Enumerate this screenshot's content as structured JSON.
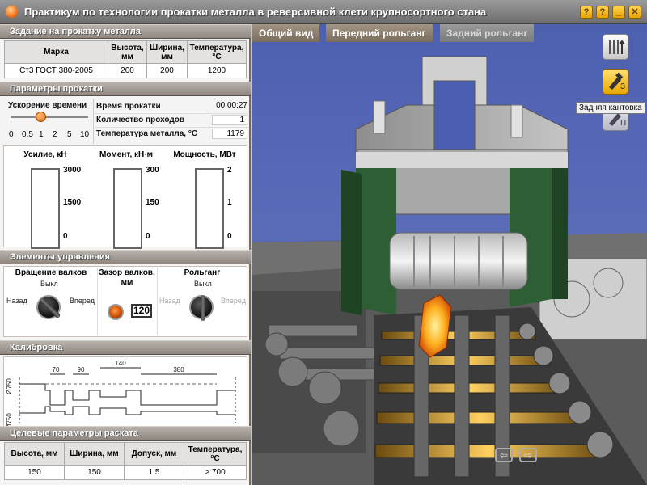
{
  "window": {
    "title": "Практикум по технологии прокатки металла в реверсивной клети крупносортного стана",
    "buttons": [
      "?",
      "?",
      "_",
      "✕"
    ]
  },
  "task": {
    "section": "Задание на прокатку металла",
    "headers": [
      "Марка",
      "Высота, мм",
      "Ширина, мм",
      "Температура, °С"
    ],
    "row": [
      "Ст3 ГОСТ 380-2005",
      "200",
      "200",
      "1200"
    ]
  },
  "params": {
    "section": "Параметры прокатки",
    "accel_label": "Ускорение времени",
    "accel_ticks": [
      "0",
      "0.5",
      "1",
      "2",
      "5",
      "10"
    ],
    "accel_value": 1,
    "time_label": "Время прокатки",
    "time_value": "00:00:27",
    "passes_label": "Количество проходов",
    "passes_value": "1",
    "temp_label": "Температура металла, °С",
    "temp_value": "1179"
  },
  "gauges": [
    {
      "label": "Усилие, кН",
      "ticks": [
        "3000",
        "1500",
        "0"
      ],
      "value": 0
    },
    {
      "label": "Момент, кН·м",
      "ticks": [
        "300",
        "150",
        "0"
      ],
      "value": 0
    },
    {
      "label": "Мощность, МВт",
      "ticks": [
        "2",
        "1",
        "0"
      ],
      "value": 0
    }
  ],
  "controls": {
    "section": "Элементы управления",
    "rotation_label": "Вращение валков",
    "rotation_state": "Выкл",
    "rotation_left": "Назад",
    "rotation_right": "Вперед",
    "gap_label": "Зазор валков, мм",
    "gap_value": "120",
    "table_label": "Рольганг",
    "table_state": "Выкл",
    "table_left": "Назад",
    "table_right": "Вперед"
  },
  "calibration": {
    "section": "Калибровка",
    "top_dims": [
      "70",
      "90",
      "140",
      "380"
    ],
    "bottom_dims": [
      "150",
      "90",
      "40",
      "110",
      "40",
      "170",
      "40",
      "150"
    ],
    "side_top": "Ø750",
    "side_bottom": "Ø750"
  },
  "target": {
    "section": "Целевые параметры раската",
    "headers": [
      "Высота, мм",
      "Ширина, мм",
      "Допуск, мм",
      "Температура, °С"
    ],
    "row": [
      "150",
      "150",
      "1,5",
      "> 700"
    ]
  },
  "view": {
    "tabs": [
      "Общий вид",
      "Передний рольганг",
      "Задний рольганг"
    ],
    "active_tab": 0,
    "side_buttons": [
      {
        "icon": "roller-lines-icon",
        "sub": ""
      },
      {
        "icon": "tilter-icon",
        "sub": "З"
      },
      {
        "icon": "tilter-icon",
        "sub": "П"
      }
    ],
    "tooltip": "Задняя кантовка"
  },
  "colors": {
    "accent": "#ff7a1a",
    "section_header": "#9a928a",
    "housing_green": "#1f4a2a",
    "sky": "#5566b4"
  }
}
